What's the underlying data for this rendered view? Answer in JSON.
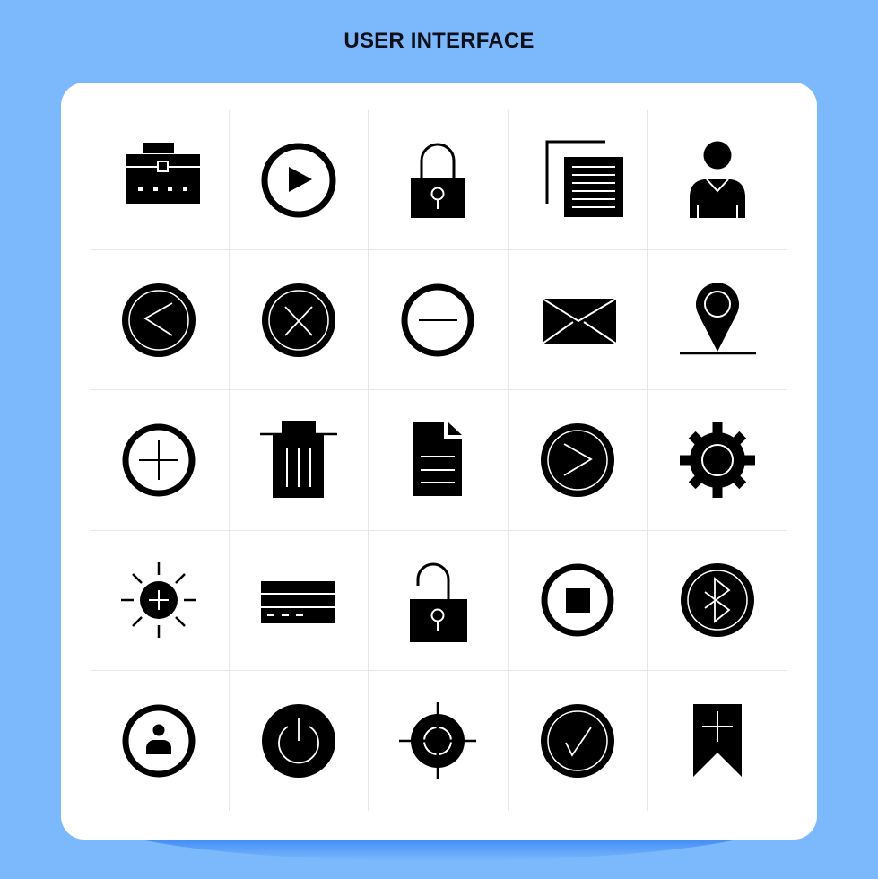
{
  "header": {
    "title": "USER INTERFACE"
  },
  "colors": {
    "background": "#7cb9fc",
    "card": "#ffffff",
    "icon": "#000000",
    "divider": "#e6e6e6",
    "shadow": "#0b3fe0"
  },
  "icons": [
    {
      "name": "briefcase"
    },
    {
      "name": "play-circle"
    },
    {
      "name": "lock"
    },
    {
      "name": "copy-document"
    },
    {
      "name": "user"
    },
    {
      "name": "chevron-left-circle"
    },
    {
      "name": "close-circle"
    },
    {
      "name": "minus-circle"
    },
    {
      "name": "mail"
    },
    {
      "name": "location-pin"
    },
    {
      "name": "plus-circle"
    },
    {
      "name": "trash"
    },
    {
      "name": "file"
    },
    {
      "name": "chevron-right-circle"
    },
    {
      "name": "gear"
    },
    {
      "name": "brightness"
    },
    {
      "name": "credit-card"
    },
    {
      "name": "unlock"
    },
    {
      "name": "stop-circle"
    },
    {
      "name": "bluetooth"
    },
    {
      "name": "user-circle"
    },
    {
      "name": "power"
    },
    {
      "name": "target"
    },
    {
      "name": "check-circle"
    },
    {
      "name": "bookmark-add"
    }
  ]
}
